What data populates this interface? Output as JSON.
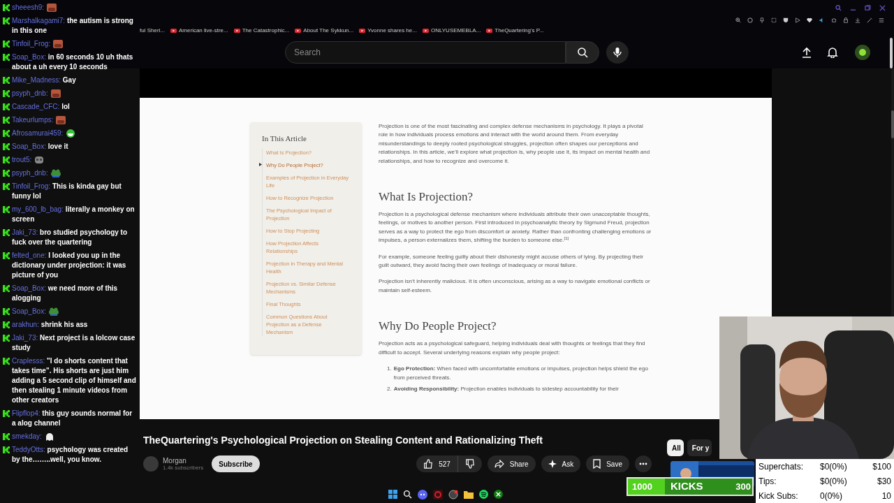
{
  "browser": {
    "bookmarks": [
      "ful Sheri...",
      "American live-stre...",
      "The Catastrophic...",
      "About The Sykkun...",
      "Yvonne shares he...",
      "ONLYUSEMEBLA...",
      "TheQuartering's P..."
    ]
  },
  "header": {
    "search": {
      "placeholder": "Search"
    }
  },
  "article": {
    "toc": {
      "title": "In This Article",
      "items": [
        {
          "label": "What Is Projection?",
          "selected": false
        },
        {
          "label": "Why Do People Project?",
          "selected": true
        },
        {
          "label": "Examples of Projection in Everyday Life",
          "selected": false
        },
        {
          "label": "How to Recognize Projection",
          "selected": false
        },
        {
          "label": "The Psychological Impact of Projection",
          "selected": false
        },
        {
          "label": "How to Stop Projecting",
          "selected": false
        },
        {
          "label": "How Projection Affects Relationships",
          "selected": false
        },
        {
          "label": "Projection in Therapy and Mental Health",
          "selected": false
        },
        {
          "label": "Projection vs. Similar Defense Mechanisms",
          "selected": false
        },
        {
          "label": "Final Thoughts",
          "selected": false
        },
        {
          "label": "Common Questions About Projection as a Defense Mechanism",
          "selected": false
        }
      ]
    },
    "blocks": [
      {
        "kind": "p",
        "text": "Projection is one of the most fascinating and complex defense mechanisms in psychology. It plays a pivotal role in how individuals process emotions and interact with the world around them. From everyday misunderstandings to deeply rooted psychological struggles, projection often shapes our perceptions and relationships. In this article, we’ll explore what projection is, why people use it, its impact on mental health and relationships, and how to recognize and overcome it."
      },
      {
        "kind": "h2",
        "text": "What Is Projection?"
      },
      {
        "kind": "p",
        "text": "Projection is a psychological defense mechanism where individuals attribute their own unacceptable thoughts, feelings, or motives to another person. First introduced in psychoanalytic theory by Sigmund Freud, projection serves as a way to protect the ego from discomfort or anxiety. Rather than confronting challenging emotions or impulses, a person externalizes them, shifting the burden to someone else.$^{[1]}$"
      },
      {
        "kind": "p",
        "text": "For example, someone feeling guilty about their dishonesty might accuse others of lying. By projecting their guilt outward, they avoid facing their own feelings of inadequacy or moral failure."
      },
      {
        "kind": "p",
        "text": "Projection isn’t inherently malicious. It is often unconscious, arising as a way to navigate emotional conflicts or maintain self-esteem."
      },
      {
        "kind": "h2",
        "text": "Why Do People Project?"
      },
      {
        "kind": "p",
        "text": "Projection acts as a psychological safeguard, helping individuals deal with thoughts or feelings that they find difficult to accept. Several underlying reasons explain why people project:"
      },
      {
        "kind": "ol",
        "items": [
          {
            "number": "1.",
            "text": "**Ego Protection:** When faced with uncomfortable emotions or impulses, projection helps shield the ego from perceived threats."
          },
          {
            "number": "2.",
            "text": "**Avoiding Responsibility:** Projection enables individuals to sidestep accountability for their"
          }
        ]
      }
    ]
  },
  "video": {
    "title": "TheQuartering's Psychological Projection on Stealing Content and Rationalizing Theft",
    "channel": "Morgan",
    "subscribers": "1.4k subscribers",
    "subscribe": "Subscribe",
    "likes": "527",
    "share": "Share",
    "ask": "Ask",
    "save": "Save"
  },
  "chips": [
    {
      "label": "All",
      "selected": true
    },
    {
      "label": "For y",
      "selected": false
    }
  ],
  "chat": [
    {
      "kind": "face",
      "user": "sheeesh9:"
    },
    {
      "kind": "text",
      "user": "Marshalkagami7:",
      "text": "the autism is strong in this one"
    },
    {
      "kind": "face",
      "user": "Tinfoil_Frog:"
    },
    {
      "kind": "text",
      "user": "Soap_Box:",
      "text": "in 60 seconds 10 uh thats about a uh every 10 seconds"
    },
    {
      "kind": "text",
      "user": "Mike_Madness:",
      "text": "Gay"
    },
    {
      "kind": "face",
      "user": "psyph_dnb:"
    },
    {
      "kind": "text",
      "user": "Cascade_CFC:",
      "text": "lol"
    },
    {
      "kind": "face",
      "user": "Takeurlumps:"
    },
    {
      "kind": "laugh",
      "user": "Afrosamurai459:"
    },
    {
      "kind": "text",
      "user": "Soap_Box:",
      "text": "love it"
    },
    {
      "kind": "skull",
      "user": "trout5:"
    },
    {
      "kind": "frog",
      "user": "psyph_dnb:"
    },
    {
      "kind": "text",
      "user": "Tinfoil_Frog:",
      "text": "This is kinda gay but funny lol"
    },
    {
      "kind": "text",
      "user": "my_600_lb_bag:",
      "text": "literally a monkey on screen"
    },
    {
      "kind": "text",
      "user": "Jaki_73:",
      "text": "bro studied psychology to fuck over the quartering"
    },
    {
      "kind": "text",
      "user": "felted_one:",
      "text": "I looked you up in the dictionary under projection: it was picture of you"
    },
    {
      "kind": "text",
      "user": "Soap_Box:",
      "text": "we need more of this alogging"
    },
    {
      "kind": "frog",
      "user": "Soap_Box:"
    },
    {
      "kind": "text",
      "user": "arakhun:",
      "text": "shrink his ass"
    },
    {
      "kind": "text",
      "user": "Jaki_73:",
      "text": "Next project is a lolcow case study"
    },
    {
      "kind": "text",
      "user": "Craplesss:",
      "text": "\"I do shorts content that takes time\". His shorts are just him adding a 5 second clip of himself and then stealing 1 minute videos from other creators"
    },
    {
      "kind": "text",
      "user": "Flipflop4:",
      "text": "this guy sounds normal for a alog channel"
    },
    {
      "kind": "ghost",
      "user": "smekday:"
    },
    {
      "kind": "text",
      "user": "TeddyOtts:",
      "text": "psychology was created by the……..well, you know."
    }
  ],
  "stream": {
    "kicks": {
      "current": "1000",
      "label": "KICKS",
      "goal": "300",
      "level": 0.3
    },
    "stats": [
      {
        "label": "Superchats:",
        "value": "$0(0%)",
        "goal": "$100"
      },
      {
        "label": "Tips:",
        "value": "$0(0%)",
        "goal": "$30"
      },
      {
        "label": "Kick Subs:",
        "value": "0(0%)",
        "goal": "10"
      }
    ]
  }
}
